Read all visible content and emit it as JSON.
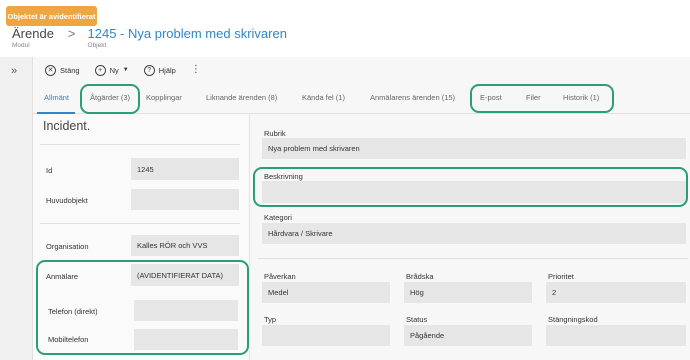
{
  "badge": "Objektet är avidentifierat",
  "breadcrumb": {
    "module": "Ärende",
    "module_sub": "Modul",
    "separator": ">",
    "object": "1245 - Nya problem med skrivaren",
    "object_sub": "Objekt"
  },
  "sidebar": {
    "expand_icon": "»"
  },
  "toolbar": {
    "close_label": "Stäng",
    "new_label": "Ny",
    "help_label": "Hjälp",
    "more": "⋮"
  },
  "tabs": [
    {
      "label": "Allmänt"
    },
    {
      "label": "Åtgärder  (3)"
    },
    {
      "label": "Kopplingar"
    },
    {
      "label": "Liknande ärenden  (8)"
    },
    {
      "label": "Kända fel  (1)"
    },
    {
      "label": "Anmälarens ärenden  (15)"
    },
    {
      "label": "E-post"
    },
    {
      "label": "Filer"
    },
    {
      "label": "Historik  (1)"
    }
  ],
  "left": {
    "title": "Incident.",
    "id_label": "Id",
    "id_value": "1245",
    "main_object_label": "Huvudobjekt",
    "main_object_value": "",
    "org_label": "Organisation",
    "org_value": "Kalles RÖR och VVS",
    "reporter_label": "Anmälare",
    "reporter_value": "(AVIDENTIFIERAT DATA)",
    "phone_label": "Telefon (direkt)",
    "phone_value": "",
    "mobile_label": "Mobiltelefon",
    "mobile_value": ""
  },
  "right": {
    "subject_label": "Rubrik",
    "subject_value": "Nya problem med skrivaren",
    "description_label": "Beskrivning",
    "description_value": "",
    "category_label": "Kategori",
    "category_value": "Hårdvara / Skrivare",
    "impact_label": "Påverkan",
    "impact_value": "Medel",
    "urgency_label": "Brådska",
    "urgency_value": "Hög",
    "priority_label": "Prioritet",
    "priority_value": "2",
    "type_label": "Typ",
    "type_value": "",
    "status_label": "Status",
    "status_value": "Pågående",
    "closing_code_label": "Stängningskod",
    "closing_code_value": ""
  },
  "colors": {
    "accent": "#2f86c9",
    "badge": "#f0a640",
    "highlight": "#2a9e78"
  }
}
